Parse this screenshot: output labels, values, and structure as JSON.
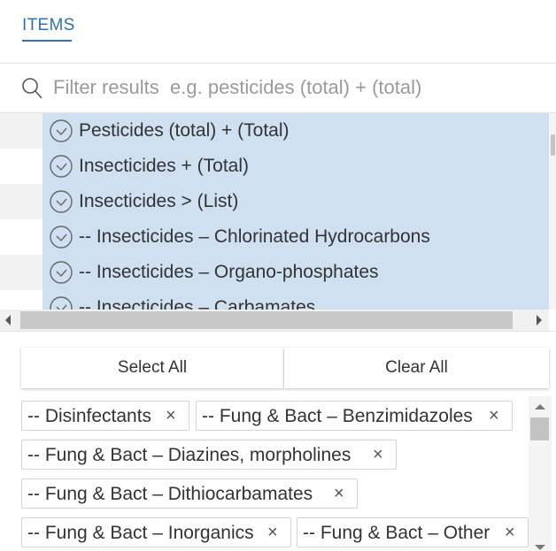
{
  "tabs": {
    "items_label": "ITEMS"
  },
  "filter": {
    "placeholder": "Filter results  e.g. pesticides (total) + (total)",
    "value": ""
  },
  "list": {
    "rows": [
      {
        "label": "Pesticides (total) + (Total)",
        "selected": true
      },
      {
        "label": "Insecticides + (Total)",
        "selected": true
      },
      {
        "label": "Insecticides > (List)",
        "selected": true
      },
      {
        "label": "-- Insecticides – Chlorinated Hydrocarbons",
        "selected": true
      },
      {
        "label": "-- Insecticides – Organo-phosphates",
        "selected": true
      },
      {
        "label": "-- Insecticides – Carbamates",
        "selected": true
      }
    ],
    "check_icon": "circle-check-icon"
  },
  "actions": {
    "select_all": "Select All",
    "clear_all": "Clear All"
  },
  "chips": [
    {
      "label": "-- Disinfectants",
      "remove": "×"
    },
    {
      "label": "-- Fung & Bact – Benzimidazoles",
      "remove": "×"
    },
    {
      "label": "-- Fung & Bact – Diazines, morpholines",
      "remove": "×"
    },
    {
      "label": "-- Fung & Bact – Dithiocarbamates",
      "remove": "×"
    },
    {
      "label": "-- Fung & Bact – Inorganics",
      "remove": "×"
    },
    {
      "label": "-- Fung & Bact – Other",
      "remove": "×"
    }
  ],
  "colors": {
    "accent": "#2f73b8",
    "selected_row": "#cfe0f1",
    "stripe": "#f2f2f2"
  }
}
